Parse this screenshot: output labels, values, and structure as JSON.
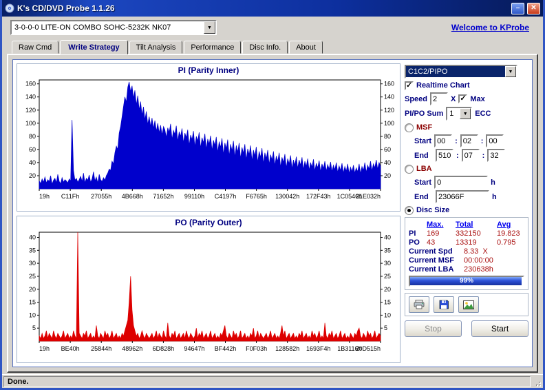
{
  "window": {
    "title": "K's CD/DVD Probe 1.1.26",
    "minimize_glyph": "–",
    "close_glyph": "✕",
    "status": "Done."
  },
  "toolbar": {
    "drive_value": "3-0-0-0 LITE-ON COMBO SOHC-5232K NK07",
    "dropdown_glyph": "▼",
    "link": "Welcome to KProbe"
  },
  "tabs": [
    {
      "label": "Raw Cmd",
      "active": false
    },
    {
      "label": "Write Strategy",
      "active": true
    },
    {
      "label": "Tilt Analysis",
      "active": false
    },
    {
      "label": "Performance",
      "active": false
    },
    {
      "label": "Disc Info.",
      "active": false
    },
    {
      "label": "About",
      "active": false
    }
  ],
  "sidebar": {
    "mode_select": {
      "value": "C1C2/PIPO"
    },
    "realtime": {
      "label": "Realtime Chart",
      "checked": true
    },
    "speed": {
      "label": "Speed",
      "value": "2",
      "unit": "X",
      "max_label": "Max",
      "max_checked": true
    },
    "sum": {
      "label": "PI/PO Sum",
      "value": "1",
      "unit": "ECC"
    },
    "msf": {
      "label": "MSF",
      "selected": false,
      "start_label": "Start",
      "end_label": "End",
      "sep": ":",
      "start": [
        "00",
        "02",
        "00"
      ],
      "end": [
        "510",
        "07",
        "32"
      ]
    },
    "lba": {
      "label": "LBA",
      "selected": false,
      "start_label": "Start",
      "end_label": "End",
      "unit": "h",
      "start": "0",
      "end": "23066F"
    },
    "disc_size": {
      "label": "Disc Size",
      "selected": true
    },
    "stats": {
      "col_headers": [
        "Max.",
        "Total",
        "Avg"
      ],
      "rows": [
        {
          "label": "PI",
          "values": [
            "169",
            "332150",
            "19.823"
          ]
        },
        {
          "label": "PO",
          "values": [
            "43",
            "13319",
            "0.795"
          ]
        }
      ],
      "current": [
        {
          "label": "Current Spd",
          "value": "8.33  X"
        },
        {
          "label": "Current MSF",
          "value": "00:00:00"
        },
        {
          "label": "Current LBA",
          "value": "230638h"
        }
      ],
      "progress": {
        "percent": 99,
        "label": "99%"
      }
    },
    "stop_label": "Stop",
    "start_label": "Start"
  },
  "icons": {
    "app": "cd-disc-icon",
    "minimize": "minimize-icon",
    "close": "close-icon",
    "dropdown": "chevron-down-icon",
    "print": "printer-icon",
    "save": "floppy-icon",
    "snapshot": "chart-image-icon"
  },
  "chart_data": [
    {
      "type": "area",
      "title": "PI (Parity Inner)",
      "color": "#0000cc",
      "ylim": [
        0,
        166
      ],
      "yticks": [
        20,
        40,
        60,
        80,
        100,
        120,
        140,
        160
      ],
      "x_labels": [
        "19h",
        "C11Fh",
        "27055h",
        "4B668h",
        "71652h",
        "99110h",
        "C4197h",
        "F6765h",
        "130042h",
        "172F43h",
        "1C0546h",
        "21E032h"
      ],
      "values": [
        12,
        8,
        15,
        10,
        18,
        9,
        14,
        11,
        20,
        7,
        13,
        16,
        9,
        22,
        11,
        8,
        17,
        10,
        14,
        12,
        9,
        15,
        12,
        105,
        28,
        13,
        16,
        10,
        14,
        19,
        11,
        24,
        9,
        16,
        13,
        21,
        10,
        15,
        26,
        12,
        18,
        9,
        22,
        14,
        11,
        17,
        13,
        20,
        24,
        30,
        28,
        42,
        38,
        55,
        65,
        60,
        85,
        95,
        110,
        125,
        140,
        132,
        155,
        163,
        148,
        157,
        138,
        150,
        128,
        142,
        120,
        133,
        112,
        125,
        105,
        118,
        98,
        110,
        95,
        108,
        92,
        104,
        88,
        100,
        85,
        97,
        82,
        95,
        90,
        78,
        93,
        86,
        99,
        75,
        89,
        83,
        96,
        72,
        87,
        80,
        92,
        70,
        85,
        78,
        90,
        66,
        82,
        75,
        88,
        64,
        80,
        73,
        86,
        62,
        78,
        70,
        84,
        60,
        76,
        68,
        81,
        58,
        74,
        66,
        79,
        55,
        72,
        63,
        77,
        52,
        70,
        61,
        75,
        50,
        68,
        58,
        73,
        48,
        66,
        56,
        70,
        46,
        63,
        54,
        68,
        44,
        61,
        52,
        66,
        42,
        59,
        50,
        64,
        40,
        57,
        48,
        62,
        38,
        55,
        46,
        59,
        37,
        52,
        44,
        57,
        35,
        50,
        42,
        55,
        33,
        48,
        40,
        53,
        32,
        46,
        38,
        51,
        30,
        44,
        36,
        49,
        31,
        44,
        36,
        48,
        29,
        42,
        34,
        46,
        28,
        40,
        33,
        45,
        27,
        39,
        32,
        43,
        26,
        38,
        31,
        42,
        27,
        37,
        30,
        41,
        26,
        36,
        29,
        40,
        25,
        35,
        28,
        39,
        24,
        34,
        27,
        38,
        23,
        33,
        26,
        36,
        24,
        32,
        26,
        38,
        23,
        34,
        28,
        40,
        25,
        36,
        30,
        42,
        27,
        38,
        32,
        44,
        30,
        40,
        34
      ]
    },
    {
      "type": "area",
      "title": "PO (Parity Outer)",
      "color": "#dd0000",
      "ylim": [
        0,
        42
      ],
      "yticks": [
        5,
        10,
        15,
        20,
        25,
        30,
        35,
        40
      ],
      "x_labels": [
        "19h",
        "BE40h",
        "25844h",
        "48962h",
        "6D828h",
        "94647h",
        "BF442h",
        "F0F03h",
        "128582h",
        "1693F4h",
        "1B3116h",
        "20D515h"
      ],
      "values": [
        2,
        1,
        3,
        1,
        2,
        4,
        1,
        3,
        2,
        1,
        4,
        2,
        1,
        3,
        2,
        1,
        2,
        4,
        1,
        2,
        3,
        1,
        2,
        1,
        4,
        2,
        1,
        42,
        3,
        2,
        1,
        3,
        2,
        4,
        1,
        2,
        3,
        1,
        2,
        1,
        6,
        2,
        1,
        3,
        2,
        1,
        4,
        2,
        3,
        1,
        2,
        4,
        1,
        2,
        3,
        1,
        2,
        1,
        3,
        2,
        4,
        6,
        8,
        15,
        25,
        12,
        6,
        4,
        2,
        3,
        1,
        2,
        4,
        2,
        1,
        3,
        2,
        1,
        2,
        3,
        1,
        2,
        4,
        1,
        3,
        2,
        1,
        4,
        2,
        1,
        7,
        2,
        1,
        3,
        2,
        4,
        1,
        2,
        3,
        1,
        2,
        3,
        1,
        4,
        2,
        1,
        3,
        2,
        1,
        2,
        5,
        1,
        3,
        2,
        4,
        1,
        2,
        3,
        1,
        2,
        4,
        1,
        2,
        3,
        1,
        2,
        1,
        3,
        2,
        4,
        6,
        2,
        1,
        3,
        2,
        1,
        4,
        2,
        3,
        1,
        2,
        4,
        1,
        2,
        3,
        1,
        2,
        1,
        3,
        2,
        5,
        1,
        2,
        4,
        1,
        3,
        2,
        1,
        2,
        3,
        1,
        2,
        4,
        1,
        2,
        3,
        1,
        2,
        1,
        3,
        6,
        2,
        4,
        1,
        2,
        3,
        1,
        2,
        3,
        1,
        2,
        1,
        3,
        2,
        4,
        1,
        2,
        3,
        1,
        2,
        1,
        4,
        2,
        3,
        1,
        2,
        4,
        1,
        2,
        1,
        7,
        2,
        1,
        3,
        2,
        4,
        1,
        2,
        3,
        1,
        2,
        4,
        1,
        2,
        3,
        1,
        2,
        1,
        3,
        2,
        1,
        3,
        2,
        4,
        5,
        2,
        1,
        3,
        2,
        1,
        4,
        2,
        3,
        1,
        2,
        4,
        1,
        2,
        3,
        2
      ]
    }
  ]
}
